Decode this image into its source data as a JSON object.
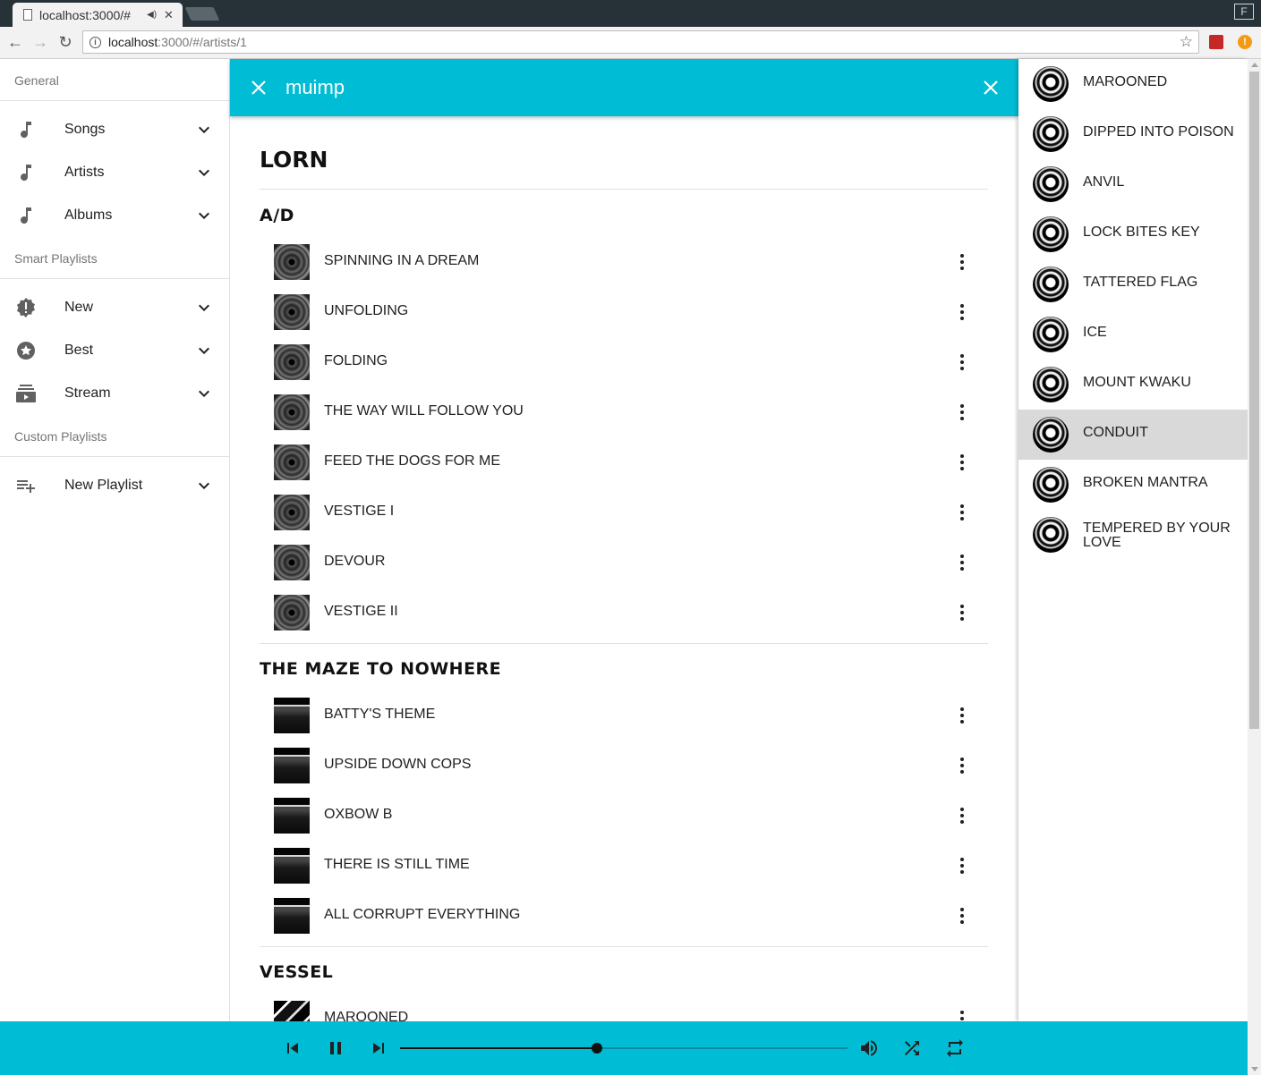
{
  "browser": {
    "tab_title": "localhost:3000/#",
    "url_host": "localhost",
    "url_path": ":3000/#/artists/1",
    "profile_letter": "F"
  },
  "sidebar": {
    "sections": [
      {
        "header": "General",
        "items": [
          {
            "label": "Songs",
            "icon": "music-note-icon"
          },
          {
            "label": "Artists",
            "icon": "music-note-icon"
          },
          {
            "label": "Albums",
            "icon": "music-note-icon"
          }
        ]
      },
      {
        "header": "Smart Playlists",
        "items": [
          {
            "label": "New",
            "icon": "new-badge-icon"
          },
          {
            "label": "Best",
            "icon": "star-circle-icon"
          },
          {
            "label": "Stream",
            "icon": "stream-icon"
          }
        ]
      },
      {
        "header": "Custom Playlists",
        "items": [
          {
            "label": "New Playlist",
            "icon": "playlist-add-icon"
          }
        ]
      }
    ]
  },
  "search": {
    "query": "muimp"
  },
  "artist": {
    "name": "LORN",
    "albums": [
      {
        "title": "A/D",
        "cover": "a",
        "tracks": [
          "SPINNING IN A DREAM",
          "UNFOLDING",
          "FOLDING",
          "THE WAY WILL FOLLOW YOU",
          "FEED THE DOGS FOR ME",
          "VESTIGE I",
          "DEVOUR",
          "VESTIGE II"
        ]
      },
      {
        "title": "THE MAZE TO NOWHERE",
        "cover": "b",
        "tracks": [
          "BATTY'S THEME",
          "UPSIDE DOWN COPS",
          "OXBOW B",
          "THERE IS STILL TIME",
          "ALL CORRUPT EVERYTHING"
        ]
      },
      {
        "title": "VESSEL",
        "cover": "c",
        "tracks": [
          "MAROONED"
        ]
      }
    ]
  },
  "queue": {
    "active_index": 7,
    "items": [
      "MAROONED",
      "DIPPED INTO POISON",
      "ANVIL",
      "LOCK BITES KEY",
      "TATTERED FLAG",
      "ICE",
      "MOUNT KWAKU",
      "CONDUIT",
      "BROKEN MANTRA",
      "TEMPERED BY YOUR LOVE"
    ]
  },
  "player": {
    "progress": 0.44,
    "controls": [
      "skip-previous-icon",
      "pause-icon",
      "skip-next-icon",
      "volume-icon",
      "shuffle-icon",
      "repeat-icon"
    ]
  },
  "colors": {
    "accent": "#00bcd4",
    "active_queue_item": "#d9d9d9"
  }
}
